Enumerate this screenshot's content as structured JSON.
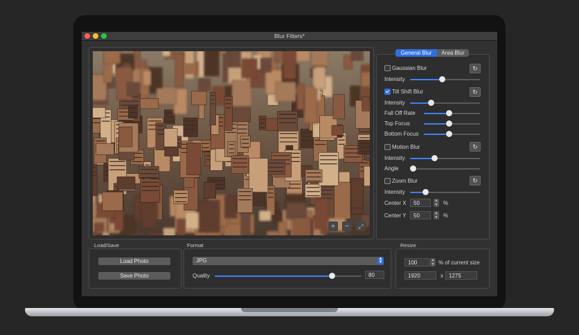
{
  "window": {
    "title": "Blur Filters*"
  },
  "tabs": [
    {
      "label": "General Blur",
      "selected": true
    },
    {
      "label": "Area Blur",
      "selected": false
    }
  ],
  "filters": {
    "gaussian": {
      "label": "Gaussian Blur",
      "checked": false,
      "intensity_label": "Intensity",
      "intensity": 0.46
    },
    "tilt_shift": {
      "label": "Tilt Shift Blur",
      "checked": true,
      "intensity_label": "Intensity",
      "intensity": 0.3,
      "fall_off_label": "Fall Off Rate",
      "fall_off": 0.45,
      "top_focus_label": "Top Focus",
      "top_focus": 0.45,
      "bottom_focus_label": "Bottom Focus",
      "bottom_focus": 0.45
    },
    "motion": {
      "label": "Motion Blur",
      "checked": false,
      "intensity_label": "Intensity",
      "intensity": 0.35,
      "angle_label": "Angle",
      "angle": 0.04
    },
    "zoom": {
      "label": "Zoom Blur",
      "checked": false,
      "intensity_label": "Intensity",
      "intensity": 0.22,
      "center_x_label": "Center X",
      "center_x": "50",
      "center_y_label": "Center Y",
      "center_y": "50",
      "percent": "%"
    }
  },
  "load_save": {
    "title": "Load/Save",
    "load_label": "Load Photo",
    "save_label": "Save Photo"
  },
  "format": {
    "title": "Format",
    "selected": "JPG",
    "quality_label": "Quality",
    "quality": "80",
    "quality_fraction": 0.8
  },
  "resize": {
    "title": "Resize",
    "percent": "100",
    "percent_label": "% of current size",
    "width": "1920",
    "times": "x",
    "height": "1275"
  },
  "icons": {
    "reset": "reset-icon",
    "zoom_in": "plus-icon",
    "zoom_out": "minus-icon",
    "fit": "expand-icon"
  },
  "colors": {
    "accent": "#3b82f6",
    "close": "#fc5f57",
    "minimize": "#fdbc2e",
    "zoom": "#27c840"
  }
}
